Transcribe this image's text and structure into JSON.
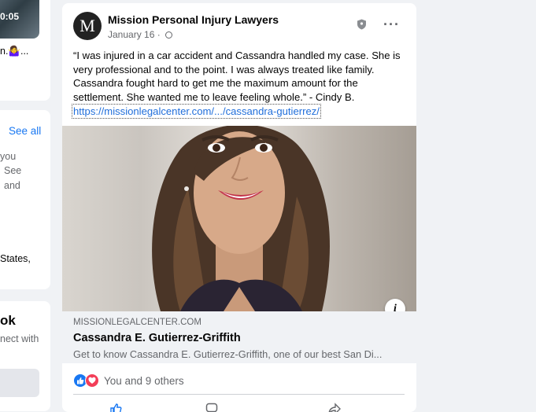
{
  "left_column": {
    "video_time": "0:05",
    "snippet_line": "n.🤷‍♀️...",
    "see_all": "See all",
    "text_lines": [
      "you",
      "See",
      "and"
    ],
    "location": "States,",
    "heading": "ok",
    "subtext": "nect with"
  },
  "post": {
    "avatar_letter": "M",
    "page_name": "Mission Personal Injury Lawyers",
    "date": "January 16",
    "date_separator": "·",
    "more_icon": "···",
    "body": "“I was injured in a car accident and Cassandra handled my case. She is very professional and to the point. I was always treated like family. Cassandra fought hard to get me the maximum amount for the settlement. She wanted me to leave feeling whole.” - Cindy B.",
    "link": "https://missionlegalcenter.com/.../cassandra-gutierrez/",
    "info_icon": "i",
    "preview": {
      "domain": "MISSIONLEGALCENTER.COM",
      "title": "Cassandra E. Gutierrez-Griffith",
      "description": "Get to know Cassandra E. Gutierrez-Griffith, one of our best San Di..."
    },
    "reactions_text": "You and 9 others",
    "colors": {
      "like": "#1877f2",
      "love": "#f33e58",
      "link": "#216fdb"
    },
    "icons": [
      "shield-icon",
      "globe-icon",
      "more-icon",
      "like-icon",
      "love-icon",
      "info-icon"
    ]
  }
}
